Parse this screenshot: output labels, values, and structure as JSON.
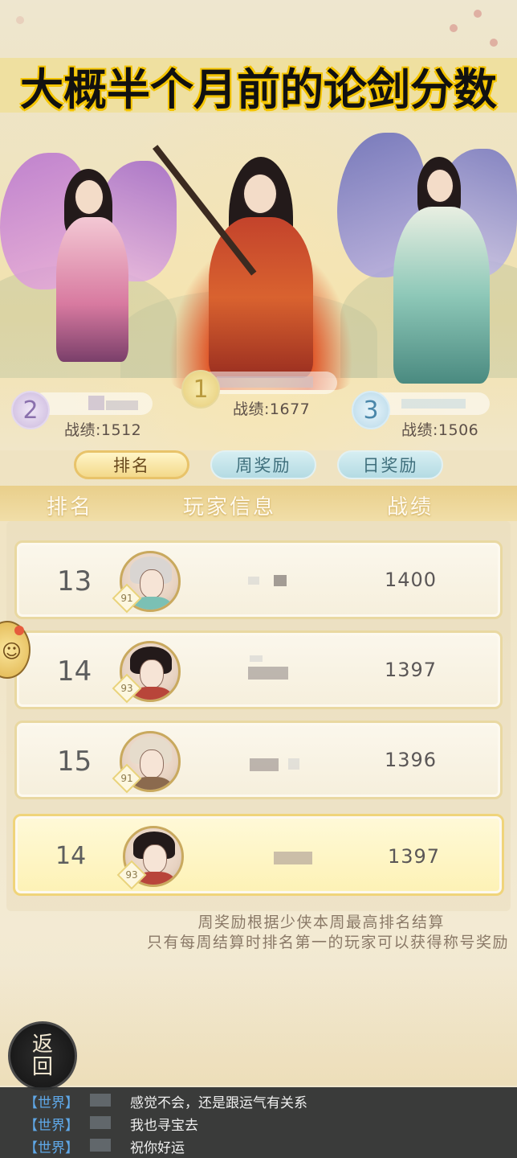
{
  "headline": "大概半个月前的论剑分数",
  "podium": [
    {
      "rank": "2",
      "score_label": "战绩:1512"
    },
    {
      "rank": "1",
      "score_label": "战绩:1677"
    },
    {
      "rank": "3",
      "score_label": "战绩:1506"
    }
  ],
  "tabs": [
    {
      "label": "排名",
      "active": true
    },
    {
      "label": "周奖励",
      "active": false
    },
    {
      "label": "日奖励",
      "active": false
    }
  ],
  "columns": {
    "rank": "排名",
    "player": "玩家信息",
    "score": "战绩"
  },
  "rows": [
    {
      "rank": "13",
      "level": "91",
      "score": "1400"
    },
    {
      "rank": "14",
      "level": "93",
      "score": "1397"
    },
    {
      "rank": "15",
      "level": "91",
      "score": "1396"
    }
  ],
  "my_row": {
    "rank": "14",
    "level": "93",
    "score": "1397"
  },
  "notes": [
    "周奖励根据少侠本周最高排名结算",
    "只有每周结算时排名第一的玩家可以获得称号奖励"
  ],
  "back_button": {
    "line1": "返",
    "line2": "回"
  },
  "chat": [
    {
      "channel": "【世界】",
      "message": "感觉不会，还是跟运气有关系"
    },
    {
      "channel": "【世界】",
      "message": "我也寻宝去"
    },
    {
      "channel": "【世界】",
      "message": "祝你好运"
    }
  ],
  "colors": {
    "accent_gold": "#f4c400",
    "tab_active": "#f3d98a",
    "tab_inactive": "#b4dbe3",
    "chat_channel": "#5fa8e8"
  }
}
